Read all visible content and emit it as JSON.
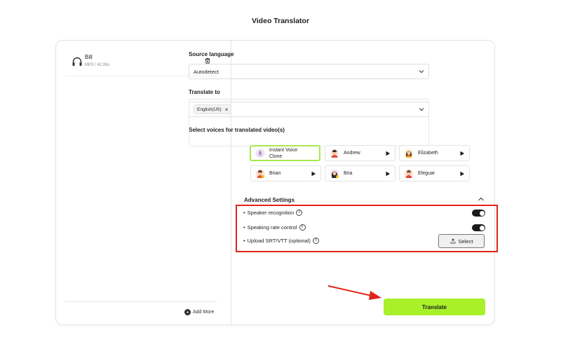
{
  "page": {
    "title": "Video Translator"
  },
  "file": {
    "name": "Bill",
    "meta": "MP3 / 42.06s"
  },
  "left": {
    "add_more": "Add More"
  },
  "source": {
    "label": "Source language",
    "value": "Autodetect"
  },
  "translate_to": {
    "label": "Translate to",
    "tags": [
      "English(US)"
    ],
    "tag_remove": "×"
  },
  "voices": {
    "label": "Select voices for translated video(s)",
    "items": [
      {
        "name_line1": "Instant Voice",
        "name_line2": "Clone",
        "selected": true,
        "icon": "voice-clone-icon"
      },
      {
        "name": "Andrew",
        "icon": "avatar-andrew"
      },
      {
        "name": "Elizabeth",
        "icon": "avatar-elizabeth"
      },
      {
        "name": "Brian",
        "icon": "avatar-brian"
      },
      {
        "name": "Bria",
        "icon": "avatar-bria"
      },
      {
        "name": "Eleguar",
        "icon": "avatar-eleguar"
      }
    ]
  },
  "advanced": {
    "title": "Advanced Settings",
    "options": [
      {
        "label": "Speaker recognition",
        "bullet": "•",
        "toggle_on": true
      },
      {
        "label": "Speaking rate control",
        "bullet": "•",
        "toggle_on": true
      },
      {
        "label": "Upload SRT/VTT (optional)",
        "bullet": "•"
      }
    ],
    "info_glyph": "!",
    "select_button": "Select"
  },
  "translate_button": "Translate",
  "colors": {
    "accent": "#a8f02a",
    "highlight_border": "#e2231a",
    "selected_voice_border": "#a8e84a"
  }
}
